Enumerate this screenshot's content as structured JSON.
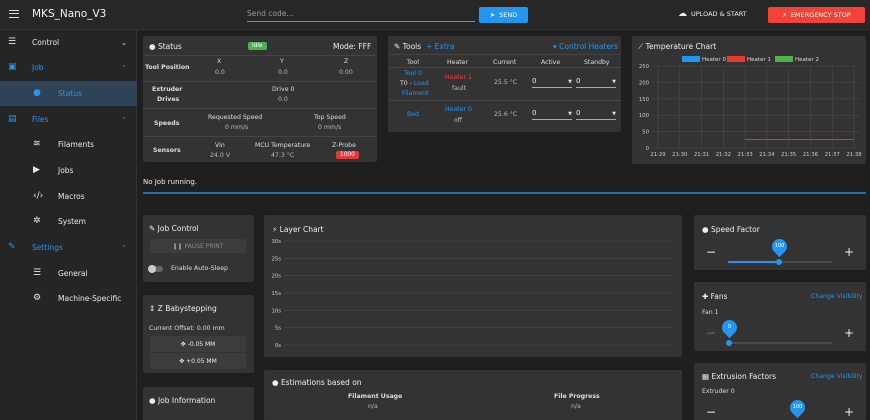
{
  "topbar": {
    "title": "MKS_Nano_V3",
    "send_placeholder": "Send code...",
    "send_label": "SEND",
    "upload_label": "UPLOAD & START",
    "estop_label": "EMERGENCY STOP"
  },
  "sidebar": {
    "control": "Control",
    "job": "Job",
    "status": "Status",
    "files": "Files",
    "filaments": "Filaments",
    "jobs": "Jobs",
    "macros": "Macros",
    "system": "System",
    "settings": "Settings",
    "general": "General",
    "machine": "Machine-Specific"
  },
  "status": {
    "title": "Status",
    "badge": "Idle",
    "mode": "Mode: FFF",
    "tool_position": "Tool Position",
    "x": "X",
    "y": "Y",
    "z": "Z",
    "xv": "0.0",
    "yv": "0.0",
    "zv": "0.00",
    "extruder_drives_1": "Extruder",
    "extruder_drives_2": "Drives",
    "drive0": "Drive 0",
    "drive0_val": "0.0",
    "speeds": "Speeds",
    "req_speed": "Requested Speed",
    "req_speed_val": "0 mm/s",
    "top_speed": "Top Speed",
    "top_speed_val": "0 mm/s",
    "sensors": "Sensors",
    "vin": "Vin",
    "vin_val": "24.0 V",
    "mcu": "MCU Temperature",
    "mcu_val": "47.3 °C",
    "zprobe": "Z-Probe",
    "zprobe_val": "1000"
  },
  "tools": {
    "title": "Tools",
    "extra": "+ Extra",
    "control_heaters": "Control Heaters",
    "h_tool": "Tool",
    "h_heater": "Heater",
    "h_current": "Current",
    "h_active": "Active",
    "h_standby": "Standby",
    "t0_name": "Tool 0",
    "t0_sub1": "T0 -",
    "t0_load": "Load",
    "t0_sub2": "Filament",
    "t0_heater": "Heater 1",
    "t0_state": "fault",
    "t0_current": "25.5 °C",
    "t0_active": "0",
    "t0_standby": "0",
    "bed_name": "Bed",
    "bed_heater": "Heater 0",
    "bed_state": "off",
    "bed_current": "25.6 °C",
    "bed_active": "0",
    "bed_standby": "0"
  },
  "temp_chart": {
    "title": "Temperature Chart",
    "legend": [
      "Heater 0",
      "Heater 1",
      "Heater 2"
    ],
    "yticks": [
      "250",
      "200",
      "150",
      "100",
      "50",
      "0"
    ],
    "xticks": [
      "21:29",
      "21:30",
      "21:31",
      "21:32",
      "21:33",
      "21:34",
      "21:35",
      "21:36",
      "21:37",
      "21:38"
    ]
  },
  "job_status": "No Job running.",
  "job_control": {
    "title": "Job Control",
    "pause": "PAUSE PRINT",
    "autosleep": "Enable Auto-Sleep"
  },
  "babystep": {
    "title": "Z Babystepping",
    "offset": "Current Offset: 0.00 mm",
    "minus": "-0.05 MM",
    "plus": "+0.05 MM"
  },
  "job_info": {
    "title": "Job Information"
  },
  "layer_chart": {
    "title": "Layer Chart",
    "yticks": [
      "30s",
      "25s",
      "20s",
      "15s",
      "10s",
      "5s",
      "0s"
    ]
  },
  "estimations": {
    "title": "Estimations based on",
    "filament": "Filament Usage",
    "filament_val": "n/a",
    "progress": "File Progress",
    "progress_val": "n/a"
  },
  "speed_factor": {
    "title": "Speed Factor",
    "value": "100",
    "minus": "−",
    "plus": "+"
  },
  "fans": {
    "title": "Fans",
    "change": "Change Visibility",
    "fan1": "Fan 1",
    "value": "0",
    "minus": "−",
    "plus": "+"
  },
  "extrusion": {
    "title": "Extrusion Factors",
    "change": "Change Visibility",
    "extruder0": "Extruder 0",
    "value": "100",
    "minus": "−",
    "plus": "+"
  },
  "colors": {
    "accent": "#2196f3",
    "estop": "#f44336",
    "heater0": "#2196f3",
    "heater1": "#e53935",
    "heater2": "#4caf50"
  },
  "chart_data": {
    "type": "line",
    "title": "Temperature Chart",
    "ylim": [
      0,
      250
    ],
    "categories": [
      "21:29",
      "21:30",
      "21:31",
      "21:32",
      "21:33",
      "21:34",
      "21:35",
      "21:36",
      "21:37",
      "21:38"
    ],
    "series": [
      {
        "name": "Heater 0",
        "values": [
          25.6,
          25.6,
          25.6,
          25.6,
          25.6,
          25.6,
          25.6,
          25.6,
          25.6,
          25.6
        ]
      },
      {
        "name": "Heater 1",
        "values": [
          25.5,
          25.5,
          25.5,
          25.5,
          25.5,
          25.5,
          25.5,
          25.5,
          25.5,
          25.5
        ]
      },
      {
        "name": "Heater 2",
        "values": []
      }
    ]
  }
}
